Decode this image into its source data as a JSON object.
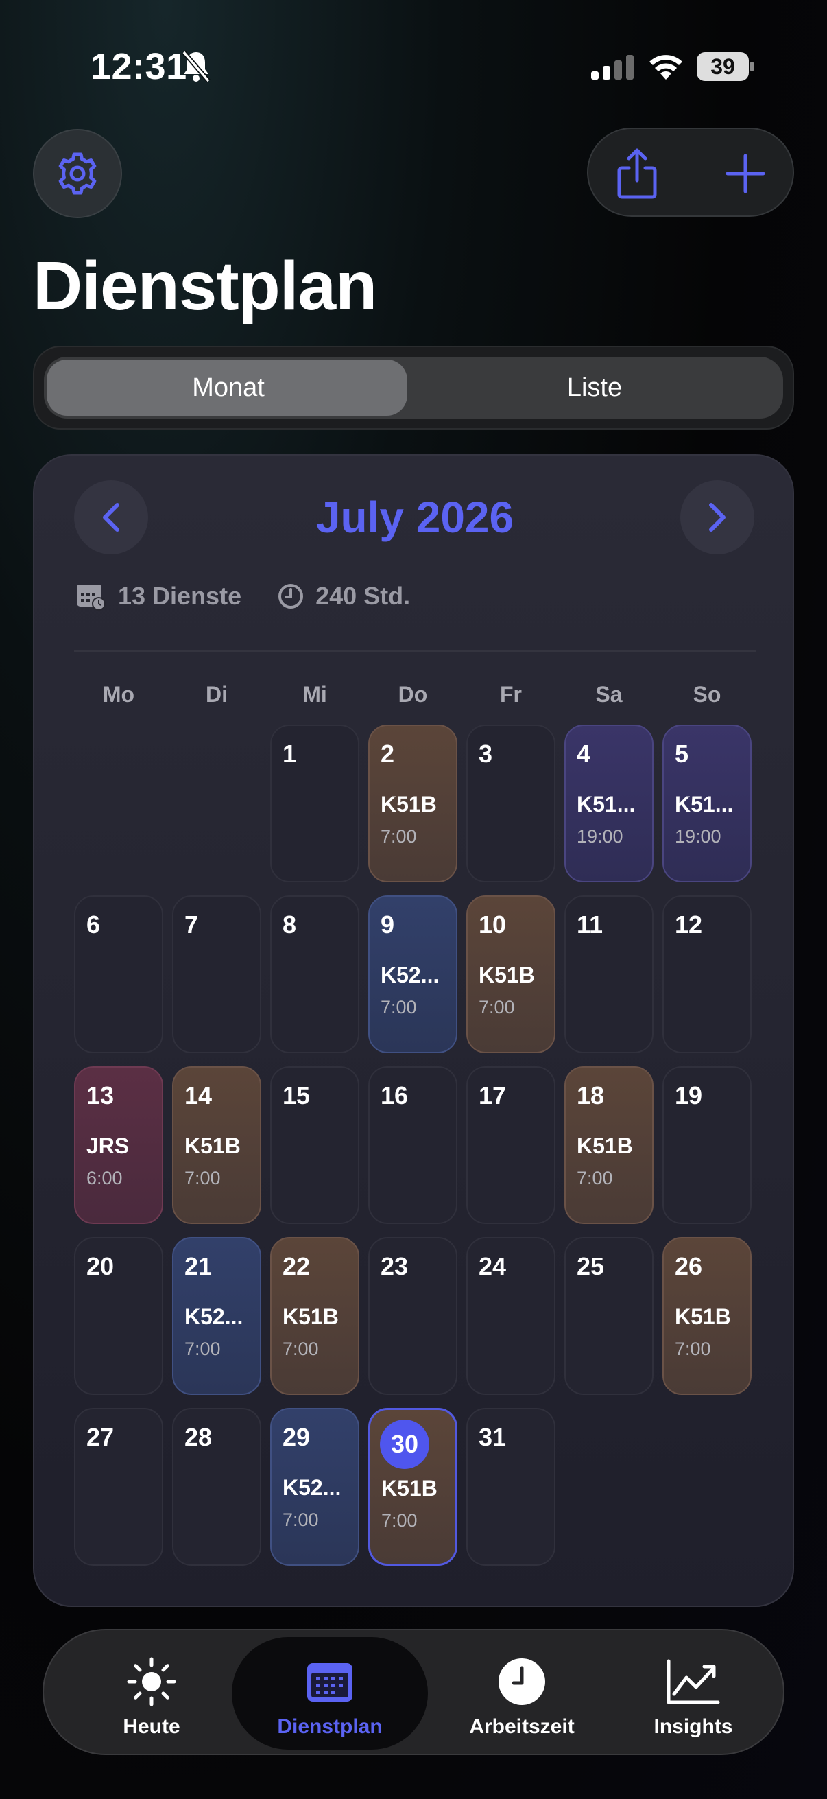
{
  "status_bar": {
    "time": "12:31",
    "battery": "39"
  },
  "header": {
    "title": "Dienstplan"
  },
  "segmented": {
    "month": "Monat",
    "list": "Liste"
  },
  "calendar": {
    "month_label": "July 2026",
    "shifts_count": "13 Dienste",
    "hours": "240 Std.",
    "weekdays": [
      "Mo",
      "Di",
      "Mi",
      "Do",
      "Fr",
      "Sa",
      "So"
    ],
    "days": [
      {
        "num": "1",
        "code": "",
        "time": "",
        "color": ""
      },
      {
        "num": "2",
        "code": "K51B",
        "time": "7:00",
        "color": "brown"
      },
      {
        "num": "3",
        "code": "",
        "time": "",
        "color": ""
      },
      {
        "num": "4",
        "code": "K51...",
        "time": "19:00",
        "color": "purple"
      },
      {
        "num": "5",
        "code": "K51...",
        "time": "19:00",
        "color": "purple"
      },
      {
        "num": "6",
        "code": "",
        "time": "",
        "color": ""
      },
      {
        "num": "7",
        "code": "",
        "time": "",
        "color": ""
      },
      {
        "num": "8",
        "code": "",
        "time": "",
        "color": ""
      },
      {
        "num": "9",
        "code": "K52...",
        "time": "7:00",
        "color": "blue"
      },
      {
        "num": "10",
        "code": "K51B",
        "time": "7:00",
        "color": "brown"
      },
      {
        "num": "11",
        "code": "",
        "time": "",
        "color": ""
      },
      {
        "num": "12",
        "code": "",
        "time": "",
        "color": ""
      },
      {
        "num": "13",
        "code": "JRS",
        "time": "6:00",
        "color": "red"
      },
      {
        "num": "14",
        "code": "K51B",
        "time": "7:00",
        "color": "brown"
      },
      {
        "num": "15",
        "code": "",
        "time": "",
        "color": ""
      },
      {
        "num": "16",
        "code": "",
        "time": "",
        "color": ""
      },
      {
        "num": "17",
        "code": "",
        "time": "",
        "color": ""
      },
      {
        "num": "18",
        "code": "K51B",
        "time": "7:00",
        "color": "brown"
      },
      {
        "num": "19",
        "code": "",
        "time": "",
        "color": ""
      },
      {
        "num": "20",
        "code": "",
        "time": "",
        "color": ""
      },
      {
        "num": "21",
        "code": "K52...",
        "time": "7:00",
        "color": "blue"
      },
      {
        "num": "22",
        "code": "K51B",
        "time": "7:00",
        "color": "brown"
      },
      {
        "num": "23",
        "code": "",
        "time": "",
        "color": ""
      },
      {
        "num": "24",
        "code": "",
        "time": "",
        "color": ""
      },
      {
        "num": "25",
        "code": "",
        "time": "",
        "color": ""
      },
      {
        "num": "26",
        "code": "K51B",
        "time": "7:00",
        "color": "brown"
      },
      {
        "num": "27",
        "code": "",
        "time": "",
        "color": ""
      },
      {
        "num": "28",
        "code": "",
        "time": "",
        "color": ""
      },
      {
        "num": "29",
        "code": "K52...",
        "time": "7:00",
        "color": "blue"
      },
      {
        "num": "30",
        "code": "K51B",
        "time": "7:00",
        "color": "brown",
        "today": true
      },
      {
        "num": "31",
        "code": "",
        "time": "",
        "color": ""
      }
    ]
  },
  "tabs": [
    {
      "label": "Heute",
      "icon": "sun-icon"
    },
    {
      "label": "Dienstplan",
      "icon": "calendar-icon",
      "active": true
    },
    {
      "label": "Arbeitszeit",
      "icon": "clock-icon"
    },
    {
      "label": "Insights",
      "icon": "chart-icon"
    }
  ],
  "colors": {
    "accent": "#5b63f2",
    "brown": "#5b4539",
    "purple": "#3a3568",
    "blue": "#32406a",
    "red": "#5b2f44"
  }
}
